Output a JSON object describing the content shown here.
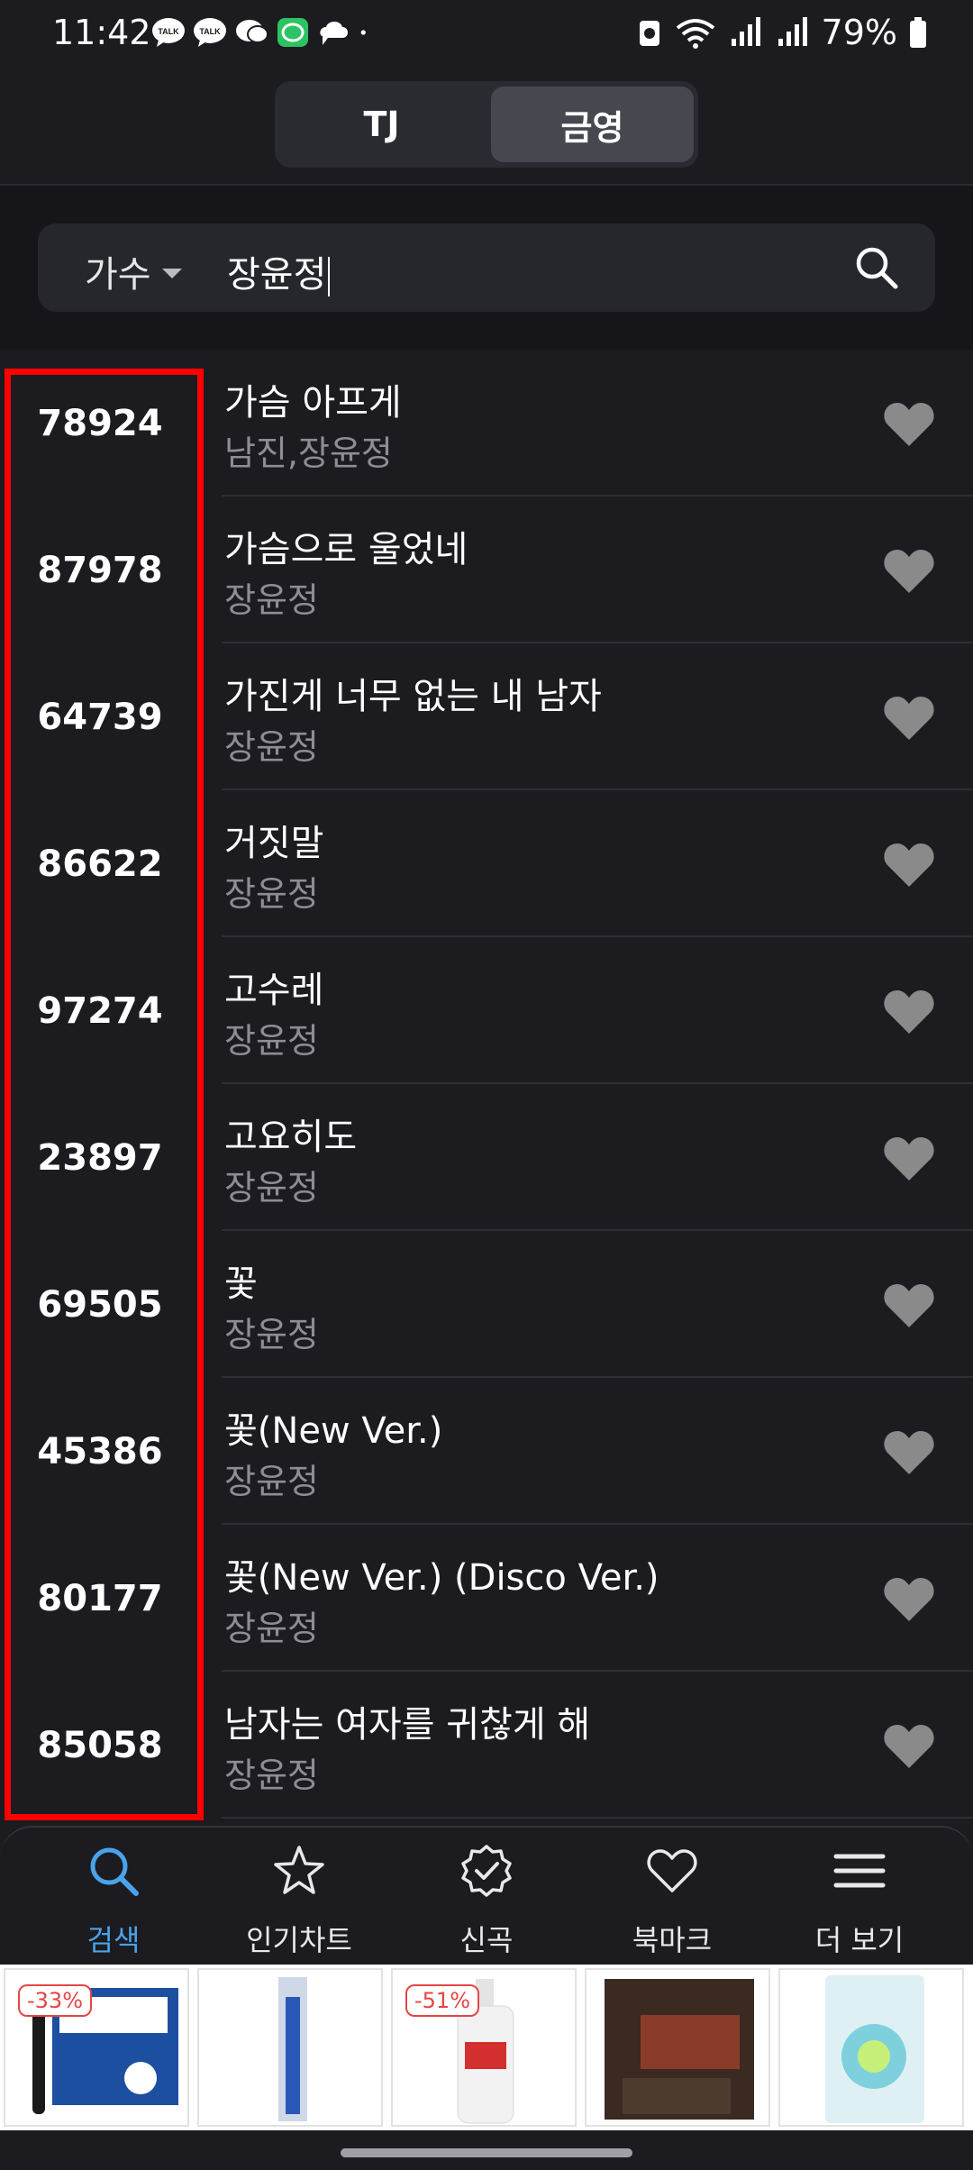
{
  "status_bar": {
    "time": "11:42",
    "battery": "79%",
    "notif_talk_1": "TALK",
    "notif_talk_2": "TALK"
  },
  "header": {
    "tabs": [
      {
        "label": "TJ",
        "selected": false
      },
      {
        "label": "금영",
        "selected": true
      }
    ]
  },
  "search": {
    "field_label": "가수",
    "query": "장윤정"
  },
  "songs": [
    {
      "number": "78924",
      "title": "가슴 아프게",
      "artist": "남진,장윤정"
    },
    {
      "number": "87978",
      "title": "가슴으로 울었네",
      "artist": "장윤정"
    },
    {
      "number": "64739",
      "title": "가진게 너무 없는 내 남자",
      "artist": "장윤정"
    },
    {
      "number": "86622",
      "title": "거짓말",
      "artist": "장윤정"
    },
    {
      "number": "97274",
      "title": "고수레",
      "artist": "장윤정"
    },
    {
      "number": "23897",
      "title": "고요히도",
      "artist": "장윤정"
    },
    {
      "number": "69505",
      "title": "꽃",
      "artist": "장윤정"
    },
    {
      "number": "45386",
      "title": "꽃(New Ver.)",
      "artist": "장윤정"
    },
    {
      "number": "80177",
      "title": "꽃(New Ver.) (Disco Ver.)",
      "artist": "장윤정"
    },
    {
      "number": "85058",
      "title": "남자는 여자를 귀찮게 해",
      "artist": "장윤정"
    }
  ],
  "bottom_nav": [
    {
      "label": "검색",
      "icon": "search-icon",
      "active": true
    },
    {
      "label": "인기차트",
      "icon": "star-icon",
      "active": false
    },
    {
      "label": "신곡",
      "icon": "new-badge-icon",
      "active": false
    },
    {
      "label": "북마크",
      "icon": "heart-icon",
      "active": false
    },
    {
      "label": "더 보기",
      "icon": "menu-icon",
      "active": false
    }
  ],
  "ads": [
    {
      "badge": "-33%"
    },
    {
      "badge": ""
    },
    {
      "badge": "-51%"
    },
    {
      "badge": ""
    },
    {
      "badge": ""
    }
  ],
  "colors": {
    "background": "#1b1b20",
    "accent": "#4aa3ea",
    "highlight": "#ff0000",
    "heart": "#8a8a8a"
  }
}
